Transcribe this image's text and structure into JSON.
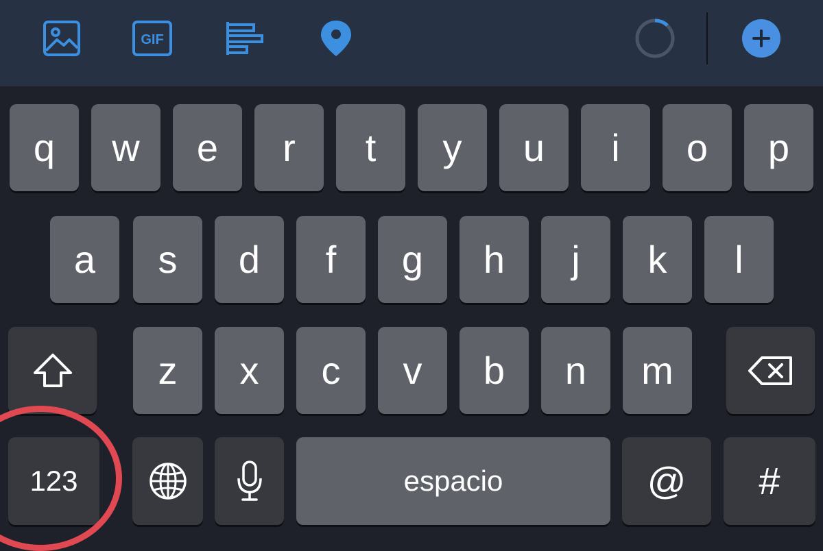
{
  "toolbar": {
    "icons": [
      "image-icon",
      "gif-icon",
      "poll-icon",
      "location-icon"
    ],
    "gif_label": "GIF",
    "accent_color": "#3d8fe0",
    "add_button_color": "#4a90e2"
  },
  "keyboard": {
    "row1": [
      "q",
      "w",
      "e",
      "r",
      "t",
      "y",
      "u",
      "i",
      "o",
      "p"
    ],
    "row2": [
      "a",
      "s",
      "d",
      "f",
      "g",
      "h",
      "j",
      "k",
      "l"
    ],
    "row3": [
      "z",
      "x",
      "c",
      "v",
      "b",
      "n",
      "m"
    ],
    "numbers_label": "123",
    "space_label": "espacio",
    "at_label": "@",
    "hash_label": "#",
    "highlight_color": "#e04852"
  }
}
